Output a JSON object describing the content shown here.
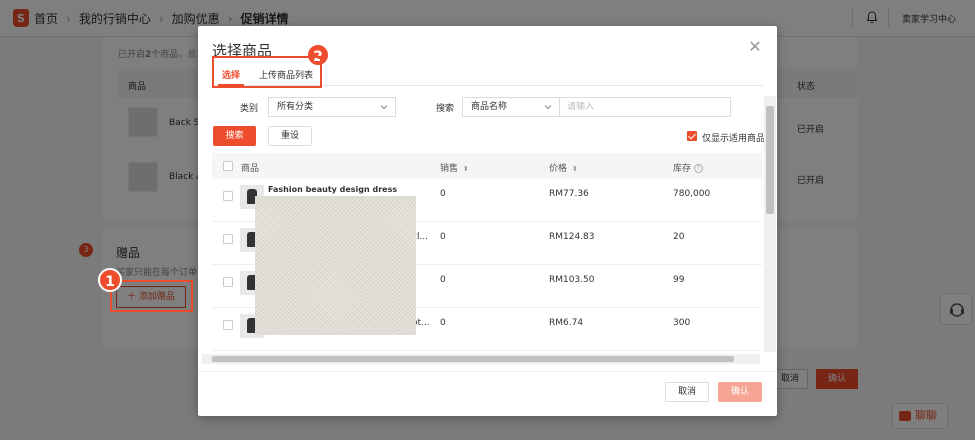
{
  "header": {
    "logo_letter": "S",
    "breadcrumbs": [
      "首页",
      "我的行销中心",
      "加购优惠",
      "促销详情"
    ],
    "seller_label": "卖家学习中心"
  },
  "background": {
    "enabled_text_prefix": "已开启",
    "enabled_count": "2",
    "enabled_text_suffix": "个商品，总共",
    "table_col_product": "商品",
    "table_col_status": "状态",
    "rows": [
      {
        "name": "Back Sh",
        "status": "已开启"
      },
      {
        "name": "Black A",
        "status": "已开启"
      }
    ],
    "gift_step": "3",
    "gift_title": "赠品",
    "gift_desc": "买家只能在每个订单中",
    "add_gift_label": "添加赠品",
    "cancel_label": "取消",
    "confirm_label": "确认",
    "chat_label": "聊聊"
  },
  "annotations": {
    "badge1": "1",
    "badge2": "2"
  },
  "modal": {
    "title": "选择商品",
    "tabs": [
      {
        "label": "选择",
        "active": true
      },
      {
        "label": "上传商品列表",
        "active": false
      }
    ],
    "filter": {
      "category_label": "类别",
      "category_value": "所有分类",
      "search_label": "搜索",
      "search_field_value": "商品名称",
      "search_placeholder": "请输入",
      "search_button": "搜索",
      "reset_button": "重设",
      "only_applicable_label": "仅显示适用商品",
      "only_applicable_checked": true
    },
    "table": {
      "columns": [
        "商品",
        "销售",
        "价格",
        "库存"
      ],
      "rows": [
        {
          "name": "Fashion beauty design dress",
          "tail": "",
          "sales": "0",
          "price": "RM77.36",
          "stock": "780,000"
        },
        {
          "name": "",
          "tail": "cl...",
          "sales": "0",
          "price": "RM124.83",
          "stock": "20"
        },
        {
          "name": "",
          "tail": "",
          "sales": "0",
          "price": "RM103.50",
          "stock": "99"
        },
        {
          "name": "",
          "tail": "ot...",
          "sales": "0",
          "price": "RM6.74",
          "stock": "300"
        }
      ]
    },
    "cancel_button": "取消",
    "confirm_button": "确认"
  },
  "colors": {
    "accent": "#ee4d2d",
    "disabled": "#f6a595",
    "overlay": "rgba(0,0,0,0.5)"
  }
}
